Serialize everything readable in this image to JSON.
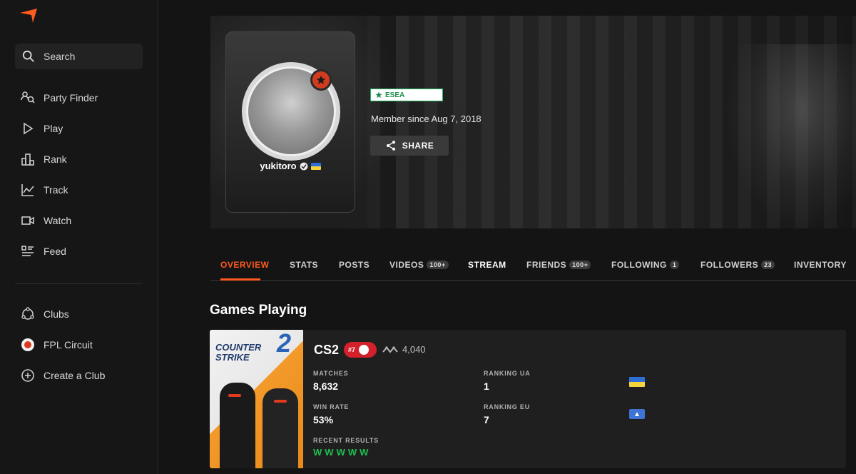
{
  "sidebar": {
    "search_label": "Search",
    "items": [
      {
        "label": "Party Finder",
        "icon": "party-finder-icon"
      },
      {
        "label": "Play",
        "icon": "play-icon"
      },
      {
        "label": "Rank",
        "icon": "rank-icon"
      },
      {
        "label": "Track",
        "icon": "track-icon"
      },
      {
        "label": "Watch",
        "icon": "watch-icon"
      },
      {
        "label": "Feed",
        "icon": "feed-icon"
      }
    ],
    "clubs": [
      {
        "label": "Clubs",
        "icon": "clubs-icon"
      },
      {
        "label": "FPL Circuit",
        "icon": "fpl-circuit-icon"
      },
      {
        "label": "Create a Club",
        "icon": "plus-circle-icon"
      }
    ]
  },
  "profile": {
    "username": "yukitoro",
    "esea_label": "ESEA",
    "member_since": "Member since Aug 7, 2018",
    "share_label": "SHARE"
  },
  "tabs": [
    {
      "label": "OVERVIEW",
      "count": null,
      "active": true
    },
    {
      "label": "STATS",
      "count": null,
      "active": false
    },
    {
      "label": "POSTS",
      "count": null,
      "active": false
    },
    {
      "label": "VIDEOS",
      "count": "100+",
      "active": false
    },
    {
      "label": "STREAM",
      "count": null,
      "active": false
    },
    {
      "label": "FRIENDS",
      "count": "100+",
      "active": false
    },
    {
      "label": "FOLLOWING",
      "count": "1",
      "active": false
    },
    {
      "label": "FOLLOWERS",
      "count": "23",
      "active": false
    },
    {
      "label": "INVENTORY",
      "count": null,
      "active": false
    }
  ],
  "games_section": {
    "title": "Games Playing",
    "game": {
      "cover_title_line1": "COUNTER",
      "cover_title_line2": "STRIKE",
      "cover_title_num": "2",
      "name": "CS2",
      "rank_position": "#7",
      "elo": "4,040",
      "matches_label": "MATCHES",
      "matches_value": "8,632",
      "win_rate_label": "WIN RATE",
      "win_rate_value": "53%",
      "recent_results_label": "RECENT RESULTS",
      "recent_results": [
        "W",
        "W",
        "W",
        "W",
        "W"
      ],
      "ranking_ua_label": "RANKING UA",
      "ranking_ua_value": "1",
      "ranking_eu_label": "RANKING EU",
      "ranking_eu_value": "7"
    }
  },
  "colors": {
    "accent": "#ff5a1f",
    "win": "#1fbf4f",
    "esea_green": "#1a8f4a"
  }
}
